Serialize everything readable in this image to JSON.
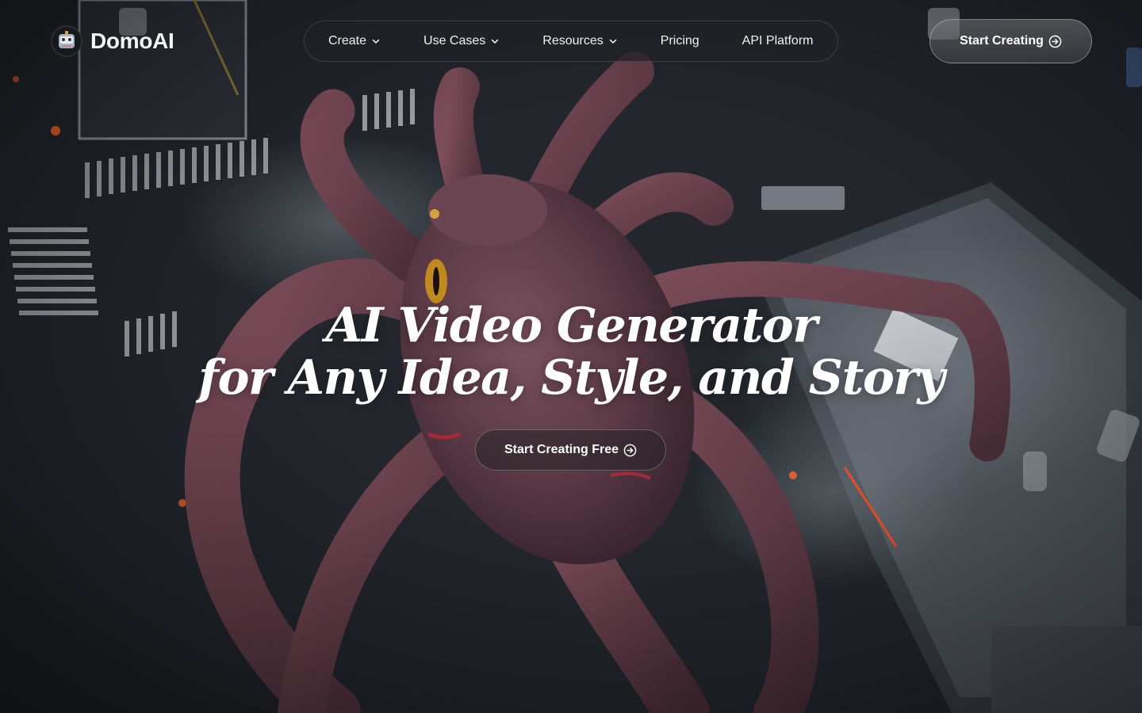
{
  "brand": {
    "name": "DomoAI",
    "logo_icon": "robot-face-icon"
  },
  "nav": {
    "items": [
      {
        "label": "Create",
        "has_dropdown": true
      },
      {
        "label": "Use Cases",
        "has_dropdown": true
      },
      {
        "label": "Resources",
        "has_dropdown": true
      },
      {
        "label": "Pricing",
        "has_dropdown": false
      },
      {
        "label": "API Platform",
        "has_dropdown": false
      }
    ],
    "cta_label": "Start Creating"
  },
  "hero": {
    "headline_line1": "AI Video Generator",
    "headline_line2": "for Any Idea, Style, and Story",
    "cta_label": "Start Creating Free",
    "background": "giant-octopus-over-city-image"
  },
  "colors": {
    "octopus": "#6b4450",
    "octopus_dark": "#3e2a33",
    "street": "#2b2f36",
    "fire": "#ff5a2a"
  }
}
